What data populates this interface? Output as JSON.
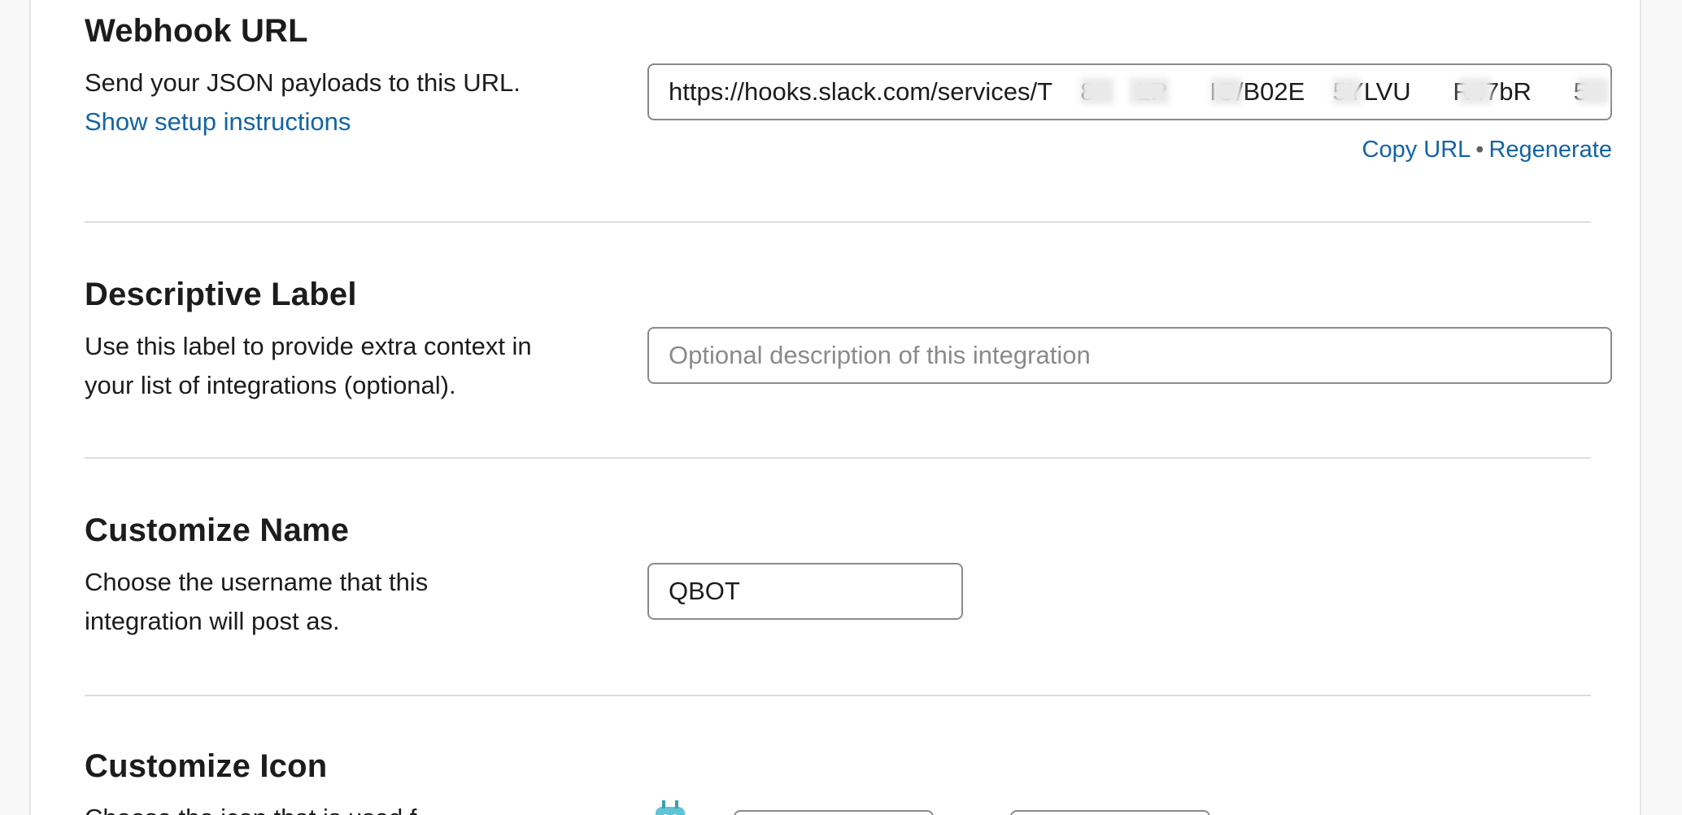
{
  "webhook": {
    "title": "Webhook URL",
    "desc": "Send your JSON payloads to this URL.",
    "setup_link": "Show setup instructions",
    "url": "https://hooks.slack.com/services/T  8   LP   IG/B02E  5YLVU   R47bR   5",
    "copy_label": "Copy URL",
    "separator": "•",
    "regenerate_label": "Regenerate"
  },
  "label": {
    "title": "Descriptive Label",
    "desc": "Use this label to provide extra context in your list of integrations (optional).",
    "placeholder": "Optional description of this integration"
  },
  "name": {
    "title": "Customize Name",
    "desc": "Choose the username that this integration will post as.",
    "value": "QBOT"
  },
  "icon": {
    "title": "Customize Icon",
    "desc": "Choose the icon that is used f"
  },
  "colors": {
    "link": "#1264a3",
    "text": "#1d1c1d",
    "border": "#8a8a8a",
    "divider": "#dddddd"
  }
}
